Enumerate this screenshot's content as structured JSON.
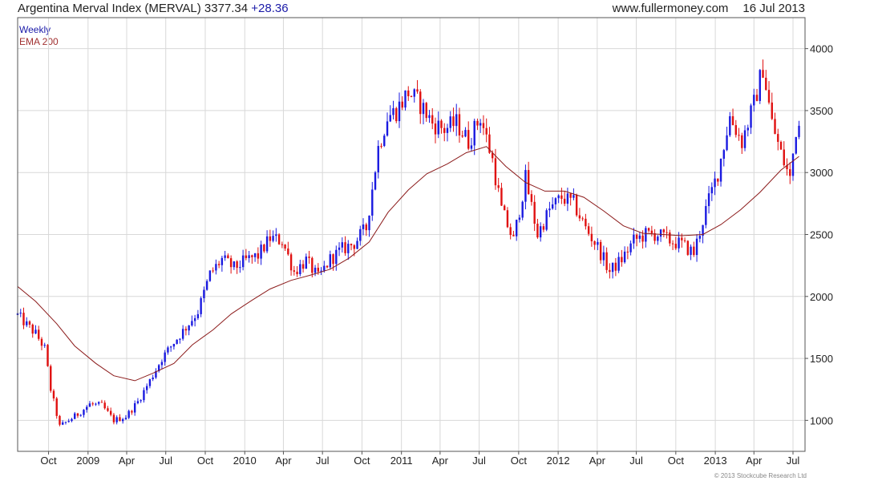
{
  "header": {
    "title": "Argentina Merval Index (MERVAL)",
    "price": "3377.34",
    "change": "+28.36",
    "source": "www.fullermoney.com",
    "date": "16 Jul 2013"
  },
  "legend": {
    "weekly": "Weekly",
    "ema": "EMA 200"
  },
  "copyright": "© 2013 Stockcube Research Ltd",
  "colors": {
    "up": "#1a1ae0",
    "down": "#e01010",
    "ema": "#8b1a1a",
    "grid": "#d8d8d8",
    "frame": "#555555"
  },
  "chart_data": {
    "type": "candlestick",
    "title": "Argentina Merval Index (MERVAL)",
    "ylim": [
      750,
      4250
    ],
    "grid": true,
    "yticks": [
      1000,
      1500,
      2000,
      2500,
      3000,
      3500,
      4000
    ],
    "xticks": [
      "Oct",
      "2009",
      "Apr",
      "Jul",
      "Oct",
      "2010",
      "Apr",
      "Jul",
      "Oct",
      "2011",
      "Apr",
      "Jul",
      "Oct",
      "2012",
      "Apr",
      "Jul",
      "Oct",
      "2013",
      "Apr",
      "Jul"
    ],
    "x_start": "2008-07-21",
    "x_end": "2013-07-29",
    "series": [
      {
        "name": "Weekly",
        "kind": "ohlc-close",
        "x": [
          "2008-07-21",
          "2008-08-11",
          "2008-09-01",
          "2008-09-22",
          "2008-10-06",
          "2008-10-27",
          "2008-11-17",
          "2008-12-08",
          "2009-01-05",
          "2009-02-02",
          "2009-03-02",
          "2009-03-30",
          "2009-04-27",
          "2009-05-25",
          "2009-06-22",
          "2009-07-20",
          "2009-08-17",
          "2009-09-14",
          "2009-10-12",
          "2009-11-09",
          "2009-12-07",
          "2010-01-04",
          "2010-02-01",
          "2010-03-01",
          "2010-03-29",
          "2010-04-26",
          "2010-05-24",
          "2010-06-21",
          "2010-07-19",
          "2010-08-16",
          "2010-09-13",
          "2010-10-11",
          "2010-11-08",
          "2010-11-29",
          "2010-12-20",
          "2011-01-17",
          "2011-02-14",
          "2011-03-14",
          "2011-04-11",
          "2011-05-09",
          "2011-06-06",
          "2011-07-04",
          "2011-08-01",
          "2011-08-22",
          "2011-09-19",
          "2011-10-17",
          "2011-11-14",
          "2011-12-12",
          "2012-01-09",
          "2012-02-06",
          "2012-03-05",
          "2012-04-02",
          "2012-04-30",
          "2012-05-28",
          "2012-06-25",
          "2012-07-23",
          "2012-08-20",
          "2012-09-17",
          "2012-10-15",
          "2012-11-12",
          "2012-12-10",
          "2013-01-07",
          "2013-02-04",
          "2013-03-04",
          "2013-04-01",
          "2013-04-22",
          "2013-05-13",
          "2013-06-03",
          "2013-06-24",
          "2013-07-08",
          "2013-07-15"
        ],
        "values": [
          1850,
          1770,
          1700,
          1580,
          1250,
          950,
          1000,
          1050,
          1130,
          1120,
          1000,
          1030,
          1150,
          1320,
          1500,
          1630,
          1750,
          1880,
          2180,
          2300,
          2230,
          2290,
          2330,
          2470,
          2450,
          2200,
          2290,
          2150,
          2300,
          2380,
          2430,
          2550,
          3200,
          3450,
          3500,
          3650,
          3550,
          3400,
          3350,
          3400,
          3250,
          3450,
          3100,
          2700,
          2450,
          2950,
          2500,
          2700,
          2800,
          2750,
          2550,
          2400,
          2200,
          2300,
          2450,
          2500,
          2500,
          2450,
          2420,
          2350,
          2700,
          3000,
          3450,
          3250,
          3550,
          3850,
          3400,
          3150,
          2950,
          3350,
          3377.34
        ]
      },
      {
        "name": "EMA 200",
        "kind": "line",
        "x": [
          "2008-07-21",
          "2008-09-01",
          "2008-10-20",
          "2008-12-01",
          "2009-01-19",
          "2009-03-02",
          "2009-04-20",
          "2009-06-01",
          "2009-07-20",
          "2009-09-01",
          "2009-10-19",
          "2009-12-01",
          "2010-01-18",
          "2010-03-01",
          "2010-04-19",
          "2010-06-01",
          "2010-07-19",
          "2010-09-01",
          "2010-10-18",
          "2010-12-01",
          "2011-01-17",
          "2011-03-01",
          "2011-04-18",
          "2011-06-01",
          "2011-07-18",
          "2011-09-01",
          "2011-10-17",
          "2011-12-01",
          "2012-01-16",
          "2012-03-01",
          "2012-04-16",
          "2012-06-01",
          "2012-07-16",
          "2012-09-01",
          "2012-10-15",
          "2012-12-03",
          "2013-01-14",
          "2013-03-01",
          "2013-04-15",
          "2013-06-03",
          "2013-07-15"
        ],
        "values": [
          2080,
          1960,
          1780,
          1600,
          1460,
          1360,
          1320,
          1380,
          1460,
          1610,
          1730,
          1860,
          1970,
          2060,
          2130,
          2170,
          2220,
          2310,
          2440,
          2680,
          2860,
          2990,
          3070,
          3160,
          3210,
          3050,
          2920,
          2850,
          2850,
          2800,
          2690,
          2570,
          2510,
          2500,
          2490,
          2500,
          2580,
          2700,
          2840,
          3020,
          3130
        ]
      }
    ]
  }
}
